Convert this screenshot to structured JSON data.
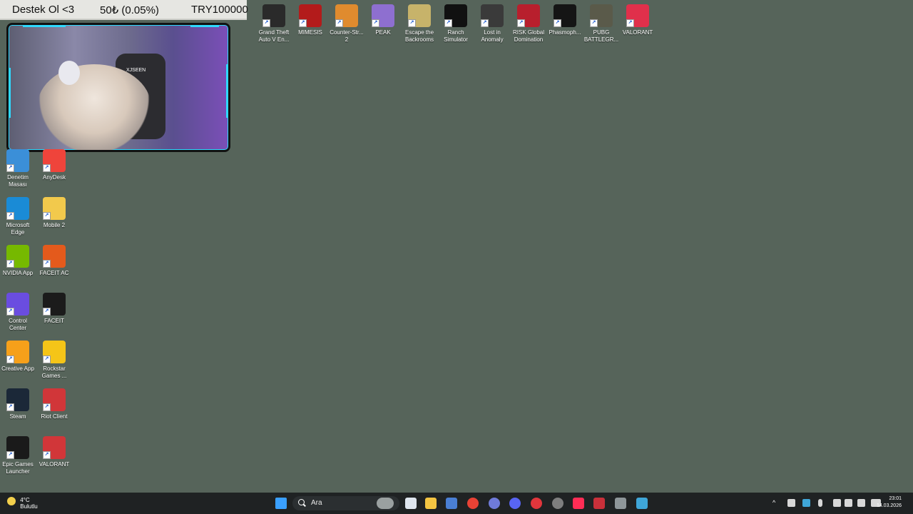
{
  "donation": {
    "text": "Destek Ol <3",
    "amount": "50₺ (0.05%)",
    "goal": "TRY100000"
  },
  "webcam": {
    "chair_label": "XJSEEN"
  },
  "desktop_icons_top": [
    {
      "label": "Grand Theft Auto V En...",
      "icon": "gta-v-icon",
      "color": "#2a2a2a"
    },
    {
      "label": "MIMESIS",
      "icon": "mimesis-icon",
      "color": "#b31b1b"
    },
    {
      "label": "Counter-Str... 2",
      "icon": "counter-strike-icon",
      "color": "#e08b2e"
    },
    {
      "label": "PEAK",
      "icon": "peak-icon",
      "color": "#8e6fd0"
    },
    {
      "label": "Escape the Backrooms",
      "icon": "escape-backrooms-icon",
      "color": "#c7b36a"
    },
    {
      "label": "Ranch Simulator",
      "icon": "ranch-simulator-icon",
      "color": "#111111"
    },
    {
      "label": "Lost in Anomaly",
      "icon": "lost-in-anomaly-icon",
      "color": "#3a3a3a"
    },
    {
      "label": "RISK Global Domination",
      "icon": "risk-icon",
      "color": "#b81f2d"
    },
    {
      "label": "Phasmoph...",
      "icon": "phasmophobia-icon",
      "color": "#151515"
    },
    {
      "label": "PUBG BATTLEGR...",
      "icon": "pubg-icon",
      "color": "#5a5a4a"
    },
    {
      "label": "VALORANT",
      "icon": "valorant-icon",
      "color": "#e0304b"
    }
  ],
  "desktop_icons_left": [
    {
      "label": "Denetim Masası",
      "icon": "control-panel-icon",
      "color": "#3b8fd8"
    },
    {
      "label": "AnyDesk",
      "icon": "anydesk-icon",
      "color": "#ef443b"
    },
    {
      "label": "Microsoft Edge",
      "icon": "edge-icon",
      "color": "#1a8bd6"
    },
    {
      "label": "Mobile 2",
      "icon": "folder-icon",
      "color": "#f2c94c"
    },
    {
      "label": "NVIDIA App",
      "icon": "nvidia-icon",
      "color": "#76b900"
    },
    {
      "label": "FACEIT AC",
      "icon": "faceit-ac-icon",
      "color": "#e45a1c"
    },
    {
      "label": "Control Center",
      "icon": "control-center-icon",
      "color": "#6a4de0"
    },
    {
      "label": "FACEIT",
      "icon": "faceit-icon",
      "color": "#1b1b1b"
    },
    {
      "label": "Creative App",
      "icon": "creative-app-icon",
      "color": "#f6a01a"
    },
    {
      "label": "Rockstar Games ...",
      "icon": "rockstar-icon",
      "color": "#f5c518"
    },
    {
      "label": "Steam",
      "icon": "steam-icon",
      "color": "#1b2838"
    },
    {
      "label": "Riot Client",
      "icon": "riot-client-icon",
      "color": "#d13639"
    },
    {
      "label": "Epic Games Launcher",
      "icon": "epic-games-icon",
      "color": "#1a1a1a"
    },
    {
      "label": "VALORANT",
      "icon": "valorant-icon",
      "color": "#d13639"
    }
  ],
  "taskbar": {
    "weather_temp": "4°C",
    "weather_desc": "Bulutlu",
    "search_placeholder": "Ara",
    "time": "23:01",
    "date": "14.03.2026"
  }
}
